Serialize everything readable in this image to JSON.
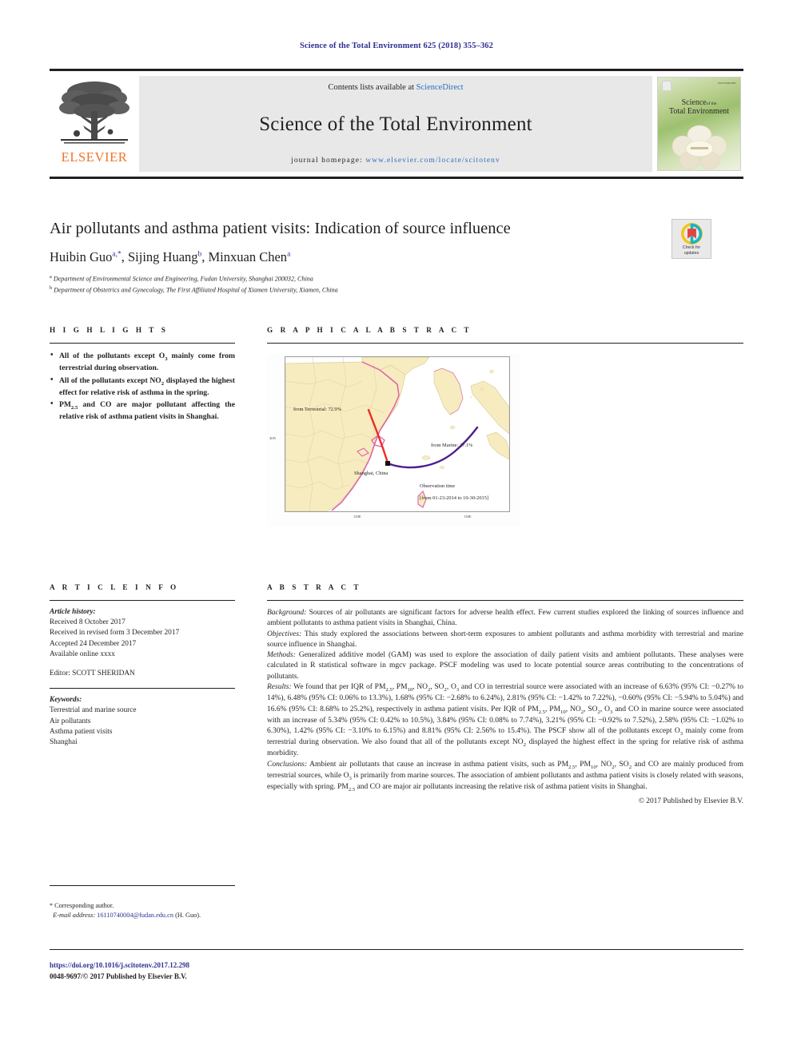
{
  "journal_ref": "Science of the Total Environment 625 (2018) 355–362",
  "masthead": {
    "publisher": "ELSEVIER",
    "contents_prefix": "Contents lists available at ",
    "contents_link": "ScienceDirect",
    "journal_title": "Science of the Total Environment",
    "homepage_prefix": "journal homepage: ",
    "homepage_url": "www.elsevier.com/locate/scitotenv",
    "cover_title_line1": "Science",
    "cover_title_line1_small": "of the",
    "cover_title_line2": "Total Environment"
  },
  "crossmark": {
    "line1": "Check for",
    "line2": "updates"
  },
  "article": {
    "title": "Air pollutants and asthma patient visits: Indication of source influence",
    "authors": [
      {
        "name": "Huibin Guo",
        "marks": "a,*"
      },
      {
        "name": "Sijing Huang",
        "marks": "b"
      },
      {
        "name": "Minxuan Chen",
        "marks": "a"
      }
    ],
    "affiliations": [
      {
        "mark": "a",
        "text": "Department of Environmental Science and Engineering, Fudan University, Shanghai 200032, China"
      },
      {
        "mark": "b",
        "text": "Department of Obstetrics and Gynecology, The First Affiliated Hospital of Xiamen University, Xiamen, China"
      }
    ]
  },
  "highlights": {
    "heading": "H I G H L I G H T S",
    "items": [
      "All of the pollutants except O₃ mainly come from terrestrial during observation.",
      "All of the pollutants except NO₂ displayed the highest effect for relative risk of asthma in the spring.",
      "PM₂.₅ and CO are major pollutant affecting the relative risk of asthma patient visits in Shanghai."
    ]
  },
  "graphical_abstract": {
    "heading": "G R A P H I C A L   A B S T R A C T",
    "figure": {
      "terrestrial_label": "from Terrestrial: 72.9%",
      "marine_label": "from Marine: 27.1%",
      "site_label": "Shanghai, China",
      "observation_caption": "Observation time",
      "observation_range": "[from 01-23-2014 to 10-30-2015]",
      "x_ticks": [
        "120E",
        "130E"
      ],
      "y_ticks": [
        "30N"
      ],
      "terrestrial_color": "#ee2a24",
      "marine_color": "#4b1f8c",
      "land_color": "#f7ecc0",
      "coast_color": "#e060a8"
    }
  },
  "article_info": {
    "heading": "A R T I C L E    I N F O",
    "history_label": "Article history:",
    "history": [
      "Received 8 October 2017",
      "Received in revised form 3 December 2017",
      "Accepted 24 December 2017",
      "Available online xxxx"
    ],
    "editor": "Editor: SCOTT SHERIDAN",
    "keywords_label": "Keywords:",
    "keywords": [
      "Terrestrial and marine source",
      "Air pollutants",
      "Asthma patient visits",
      "Shanghai"
    ]
  },
  "abstract": {
    "heading": "A B S T R A C T",
    "sections": [
      {
        "label": "Background:",
        "text": " Sources of air pollutants are significant factors for adverse health effect. Few current studies explored the linking of sources influence and ambient pollutants to asthma patient visits in Shanghai, China."
      },
      {
        "label": "Objectives:",
        "text": " This study explored the associations between short-term exposures to ambient pollutants and asthma morbidity with terrestrial and marine source influence in Shanghai."
      },
      {
        "label": "Methods:",
        "text": " Generalized additive model (GAM) was used to explore the association of daily patient visits and ambient pollutants. These analyses were calculated in R statistical software in mgcv package. PSCF modeling was used to locate potential source areas contributing to the concentrations of pollutants."
      },
      {
        "label": "Results:",
        "text": " We found that per IQR of PM2.5, PM10, NO2, SO2, O3 and CO in terrestrial source were associated with an increase of 6.63% (95% CI: −0.27% to 14%), 6.48% (95% CI: 0.06% to 13.3%), 1.68% (95% CI: −2.68% to 6.24%), 2.81% (95% CI: −1.42% to 7.22%), −0.60% (95% CI: −5.94% to 5.04%) and 16.6% (95% CI: 8.68% to 25.2%), respectively in asthma patient visits. Per IQR of PM2.5, PM10, NO2, SO2, O3 and CO in marine source were associated with an increase of 5.34% (95% CI: 0.42% to 10.5%), 3.84% (95% CI: 0.08% to 7.74%), 3.21% (95% CI: −0.92% to 7.52%), 2.58% (95% CI: −1.02% to 6.30%), 1.42% (95% CI: −3.10% to 6.15%) and 8.81% (95% CI: 2.56% to 15.4%). The PSCF show all of the pollutants except O3 mainly come from terrestrial during observation. We also found that all of the pollutants except NO2 displayed the highest effect in the spring for relative risk of asthma morbidity."
      },
      {
        "label": "Conclusions:",
        "text": " Ambient air pollutants that cause an increase in asthma patient visits, such as PM2.5, PM10, NO2, SO2 and CO are mainly produced from terrestrial sources, while O3 is primarily from marine sources. The association of ambient pollutants and asthma patient visits is closely related with seasons, especially with spring. PM2.5 and CO are major air pollutants increasing the relative risk of asthma patient visits in Shanghai."
      }
    ],
    "copyright": "© 2017 Published by Elsevier B.V."
  },
  "footnote": {
    "marker": "*",
    "corresponding": "Corresponding author.",
    "email_label": "E-mail address:",
    "email": "16110740004@fudan.edu.cn",
    "email_suffix": "(H. Guo)."
  },
  "bottom": {
    "doi": "https://doi.org/10.1016/j.scitotenv.2017.12.298",
    "issn_line": "0048-9697/© 2017 Published by Elsevier B.V."
  }
}
